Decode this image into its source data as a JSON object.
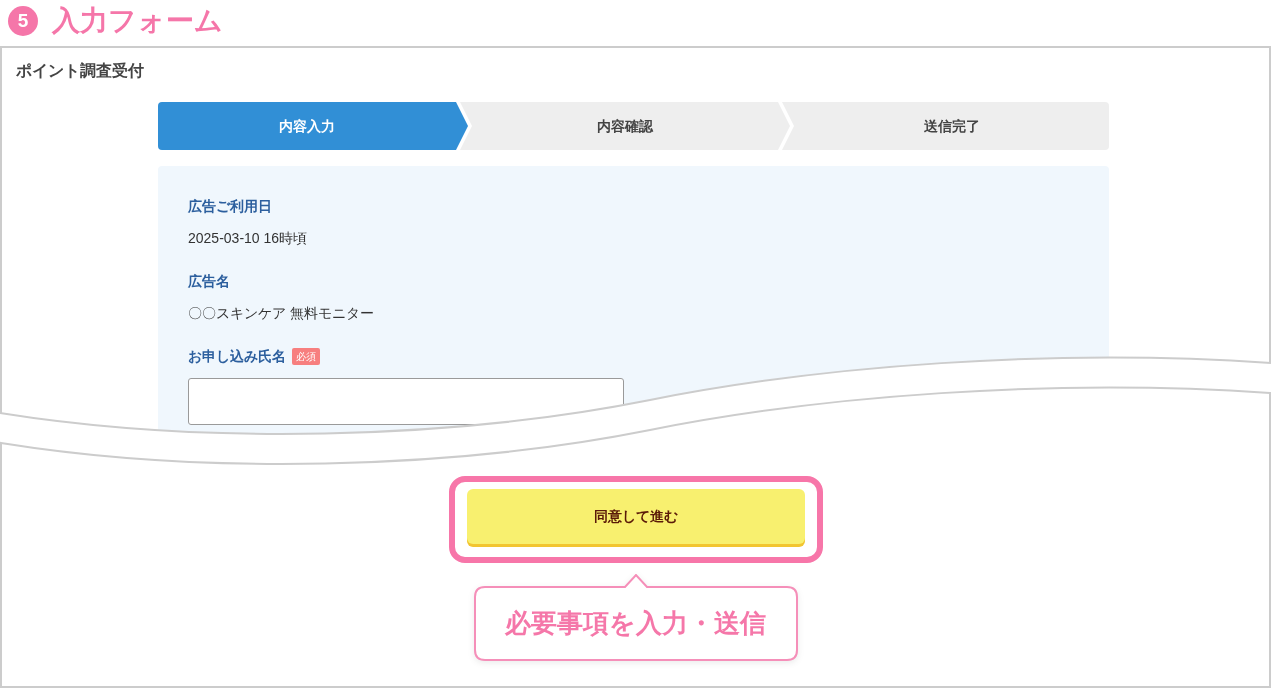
{
  "step_heading": {
    "number": "5",
    "title": "入力フォーム"
  },
  "form_page": {
    "title": "ポイント調査受付",
    "steps": [
      {
        "label": "内容入力",
        "selected": true
      },
      {
        "label": "内容確認",
        "selected": false
      },
      {
        "label": "送信完了",
        "selected": false
      }
    ],
    "fields": [
      {
        "kind": "display",
        "label": "広告ご利用日",
        "value": "2025-03-10 16時頃"
      },
      {
        "kind": "display",
        "label": "広告名",
        "value": "〇〇スキンケア 無料モニター"
      },
      {
        "kind": "input",
        "label": "お申し込み氏名",
        "badge": "必須"
      }
    ],
    "submit_button": {
      "label": "同意して進む",
      "highlighted": true
    }
  },
  "callout": {
    "text": "必要事項を入力・送信"
  }
}
